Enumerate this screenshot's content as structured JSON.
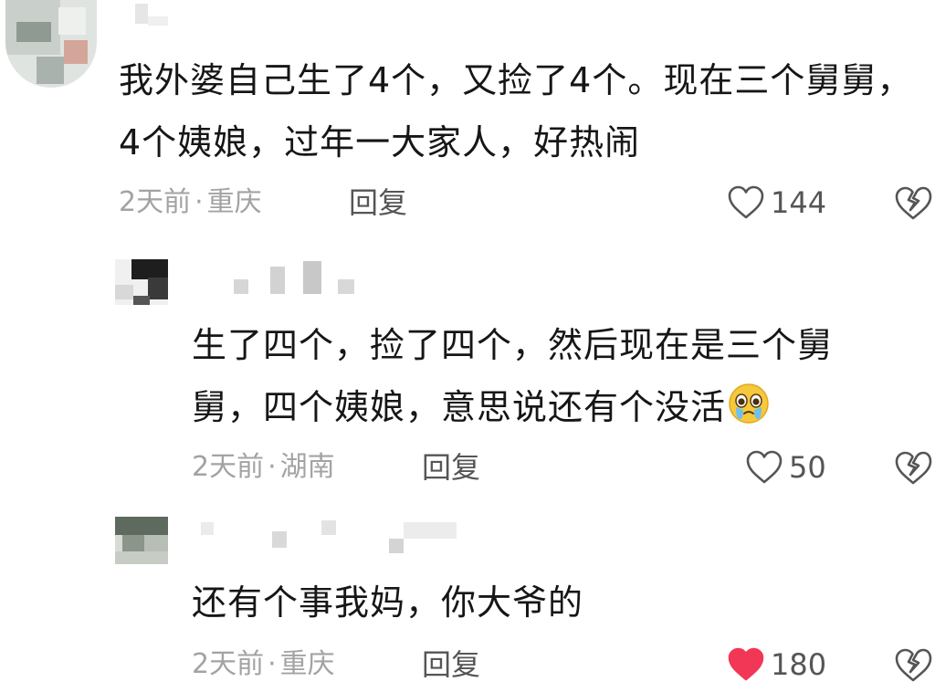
{
  "comments": [
    {
      "text": "我外婆自己生了4个，又捡了4个。现在三个舅舅，4个姨娘，过年一大家人，好热闹",
      "time": "2天前",
      "location": "重庆",
      "reply_label": "回复",
      "likes": "144",
      "liked": false
    },
    {
      "text": "生了四个，捡了四个，然后现在是三个舅舅，四个姨娘，意思说还有个没活",
      "emoji": "crying-face-emoji",
      "time": "2天前",
      "location": "湖南",
      "reply_label": "回复",
      "likes": "50",
      "liked": false
    },
    {
      "text": "还有个事我妈，你大爷的",
      "time": "2天前",
      "location": "重庆",
      "reply_label": "回复",
      "likes": "180",
      "liked": true
    }
  ],
  "meta_separator": "·",
  "colors": {
    "liked_heart": "#f23756",
    "icon_stroke": "#555555",
    "meta_text": "#a3a3a3"
  }
}
